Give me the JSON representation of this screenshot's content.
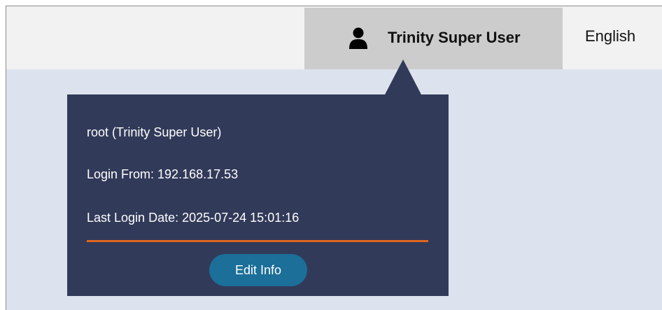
{
  "header": {
    "user_name": "Trinity Super User",
    "user_icon": "user-icon",
    "language": "English"
  },
  "popover": {
    "account": "root (Trinity Super User)",
    "login_from": "Login From: 192.168.17.53",
    "last_login": "Last Login Date: 2025-07-24 15:01:16",
    "edit_button": "Edit Info"
  },
  "colors": {
    "topbar": "#f2f2f2",
    "user_menu_bg": "#cccccc",
    "content_bg": "#dde3ee",
    "popover_bg": "#323a59",
    "divider": "#e0661f",
    "button_bg": "#1b6f99"
  }
}
